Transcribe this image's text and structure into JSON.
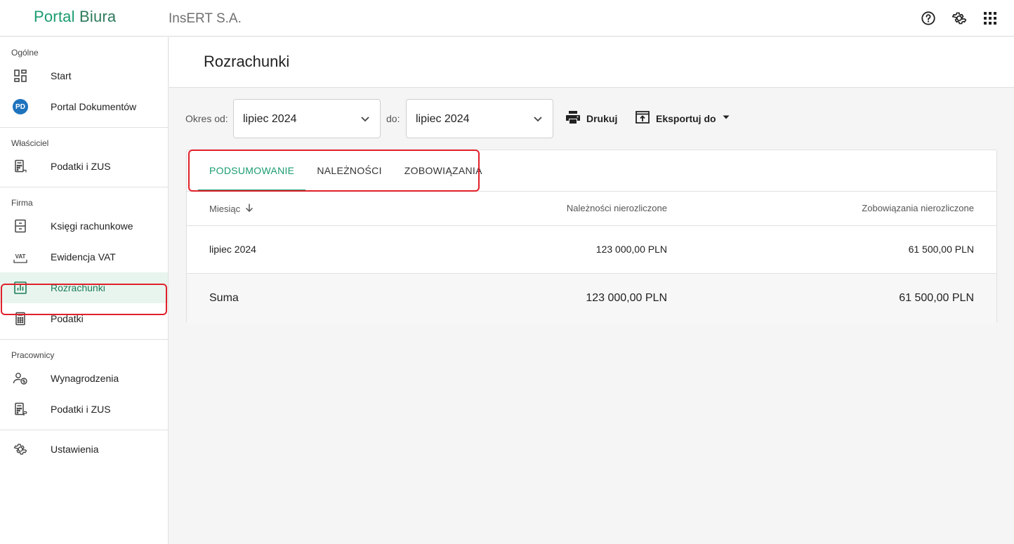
{
  "header": {
    "logo_part1": "Portal",
    "logo_part2": "Biura",
    "company": "InsERT S.A.",
    "icons": [
      "help-icon",
      "gear-icon",
      "apps-grid-icon"
    ]
  },
  "sidebar": {
    "sections": [
      {
        "label": "Ogólne",
        "items": [
          {
            "label": "Start",
            "icon": "dashboard-icon"
          },
          {
            "label": "Portal Dokumentów",
            "icon": "pd-badge-icon",
            "badge": "PD"
          }
        ]
      },
      {
        "label": "Właściciel",
        "items": [
          {
            "label": "Podatki i ZUS",
            "icon": "calculator-icon"
          }
        ]
      },
      {
        "label": "Firma",
        "items": [
          {
            "label": "Księgi rachunkowe",
            "icon": "ledger-icon"
          },
          {
            "label": "Ewidencja VAT",
            "icon": "vat-icon",
            "icon_text": "VAT"
          },
          {
            "label": "Rozrachunki",
            "icon": "bar-chart-icon",
            "active": true
          },
          {
            "label": "Podatki",
            "icon": "calculator-icon"
          }
        ]
      },
      {
        "label": "Pracownicy",
        "items": [
          {
            "label": "Wynagrodzenia",
            "icon": "person-money-icon"
          },
          {
            "label": "Podatki i ZUS",
            "icon": "calculator-icon"
          }
        ]
      }
    ],
    "settings_label": "Ustawienia"
  },
  "page": {
    "title": "Rozrachunki"
  },
  "filters": {
    "from_label": "Okres od:",
    "from_value": "lipiec 2024",
    "to_label": "do:",
    "to_value": "lipiec 2024",
    "print_label": "Drukuj",
    "export_label": "Eksportuj do"
  },
  "tabs": [
    {
      "label": "PODSUMOWANIE",
      "active": true
    },
    {
      "label": "NALEŻNOŚCI"
    },
    {
      "label": "ZOBOWIĄZANIA"
    }
  ],
  "table": {
    "columns": [
      "Miesiąc",
      "Należności nierozliczone",
      "Zobowiązania nierozliczone"
    ],
    "rows": [
      [
        "lipiec 2024",
        "123 000,00 PLN",
        "61 500,00 PLN"
      ]
    ],
    "sum": [
      "Suma",
      "123 000,00 PLN",
      "61 500,00 PLN"
    ]
  },
  "colors": {
    "accent": "#1a9c6f",
    "highlight": "#e0202a",
    "active_bg": "#e8f5ee"
  }
}
